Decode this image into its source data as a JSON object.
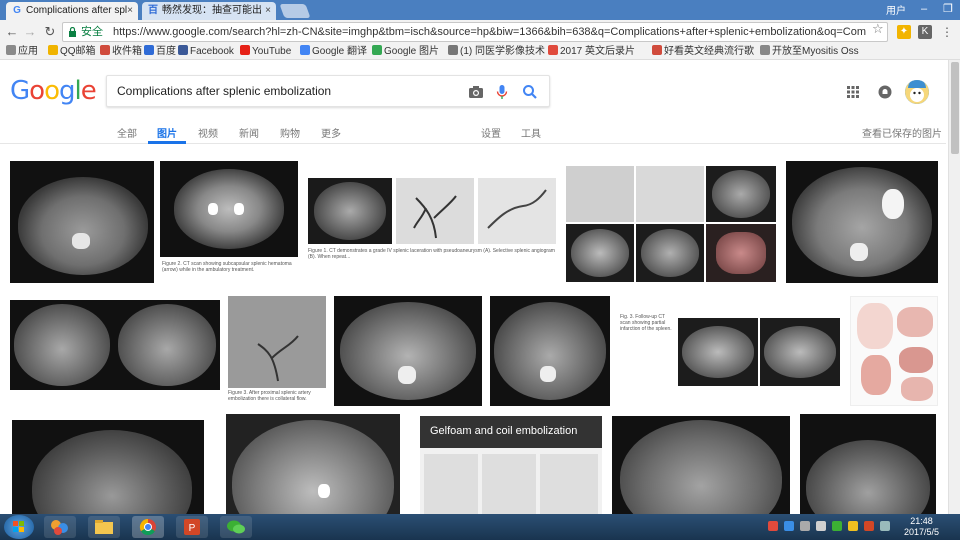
{
  "browser": {
    "tabs": [
      {
        "title": "Complications after spl",
        "favicon": "G",
        "active": true
      },
      {
        "title": "畅然发现：抽查可能出",
        "favicon": "百",
        "active": false
      }
    ],
    "window_user": "用户",
    "secure_label": "安全",
    "url": "https://www.google.com/search?hl=zh-CN&site=imghp&tbm=isch&source=hp&biw=1366&bih=638&q=Complications+after+splenic+embolization&oq=Com",
    "bookmarks": [
      {
        "label": "应用",
        "color": "#8a8a8a"
      },
      {
        "label": "QQ邮箱",
        "color": "#f0b400"
      },
      {
        "label": "收件箱",
        "color": "#d04b3c"
      },
      {
        "label": "百度",
        "color": "#2f6bd6"
      },
      {
        "label": "Facebook",
        "color": "#3b5998"
      },
      {
        "label": "YouTube",
        "color": "#e62117"
      },
      {
        "label": "Google 翻译",
        "color": "#4285f4"
      },
      {
        "label": "Google 图片",
        "color": "#34a853"
      },
      {
        "label": "(1) 同医学影像技术",
        "color": "#777"
      },
      {
        "label": "2017 英文后录片",
        "color": "#e04a3c"
      },
      {
        "label": "好看英文经典流行歌",
        "color": "#d04b3c"
      },
      {
        "label": "开放至Myositis Oss",
        "color": "#888"
      }
    ]
  },
  "search": {
    "query": "Complications after splenic embolization"
  },
  "nav_tabs": [
    {
      "label": "全部",
      "active": false
    },
    {
      "label": "图片",
      "active": true
    },
    {
      "label": "视频",
      "active": false
    },
    {
      "label": "新闻",
      "active": false
    },
    {
      "label": "购物",
      "active": false
    },
    {
      "label": "更多",
      "active": false
    }
  ],
  "tools": {
    "settings": "设置",
    "tools": "工具",
    "saved": "查看已保存的图片"
  },
  "results": {
    "gelfoam_title": "Gelfoam and coil embolization",
    "thumb_captions": [
      "Figure 2. CT scan showing subcapsular splenic hematoma (arrow) while in the ambulatory treatment.",
      "Figure 1. CT demonstrates a grade IV splenic laceration with pseudoaneurysm (A). Selective splenic angiogram (B). When repeat...",
      "Fig. 3. Follow-up CT scan showing partial infarction of the spleen.",
      "Figure 3. After proximal splenic artery embolization there is collateral flow."
    ]
  },
  "taskbar": {
    "time": "21:48",
    "date": "2017/5/5"
  },
  "colors": {
    "accent": "#1a73e8",
    "tabstrip": "#4a7fc0"
  }
}
